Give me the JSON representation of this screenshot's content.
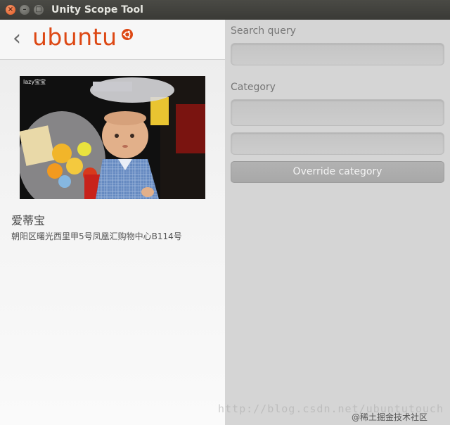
{
  "window": {
    "title": "Unity Scope Tool",
    "controls": {
      "close": "×",
      "minimize": "–",
      "maximize": "□"
    }
  },
  "preview": {
    "back_glyph": "‹",
    "logo_text": "ubuntu",
    "photo_tag": "lazy宝宝",
    "item_title": "爱蒂宝",
    "item_subtitle": "朝阳区曙光西里甲5号凤凰汇购物中心B114号"
  },
  "controls": {
    "search_label": "Search query",
    "search_value": "",
    "category_label": "Category",
    "category_value": "",
    "category_override_value": "",
    "override_button_label": "Override category"
  },
  "watermark": {
    "url": "http://blog.csdn.net/ubuntutouch",
    "credit": "@稀土掘金技术社区"
  },
  "colors": {
    "accent": "#dd4814",
    "titlebar": "#3c3b37",
    "panel_right": "#d5d5d5"
  }
}
